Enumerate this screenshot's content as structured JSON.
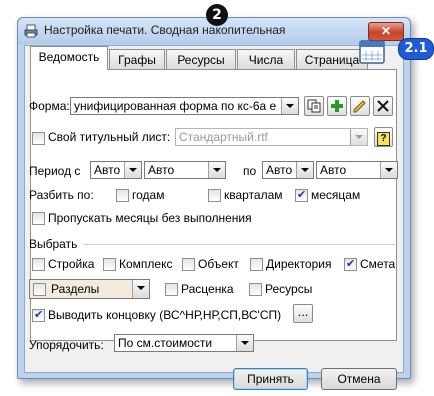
{
  "window": {
    "title": "Настройка печати. Сводная накопительная",
    "close_glyph": "✕"
  },
  "markers": {
    "main": "2",
    "secondary": "2.1"
  },
  "tabs": [
    {
      "label": "Ведомость",
      "active": true
    },
    {
      "label": "Графы",
      "active": false
    },
    {
      "label": "Ресурсы",
      "active": false
    },
    {
      "label": "Числа",
      "active": false
    },
    {
      "label": "Страница",
      "active": false
    }
  ],
  "form": {
    "label": "Форма:",
    "value": "унифицированная форма по кс-6а е"
  },
  "title_page": {
    "checkbox_label": "Свой титульный лист:",
    "checked": false,
    "value": "Стандартный.rtf"
  },
  "period": {
    "from_label": "Период с",
    "to_label": "по",
    "from_1": "Авто",
    "from_2": "Авто",
    "to_1": "Авто",
    "to_2": "Авто"
  },
  "split": {
    "label": "Разбить по:",
    "years": {
      "label": "годам",
      "checked": false
    },
    "quarters": {
      "label": "кварталам",
      "checked": false
    },
    "months": {
      "label": "месяцам",
      "checked": true
    }
  },
  "skip_months": {
    "label": "Пропускать месяцы без выполнения",
    "checked": false
  },
  "select": {
    "heading": "Выбрать",
    "items": [
      {
        "label": "Стройка",
        "checked": false
      },
      {
        "label": "Комплекс",
        "checked": false
      },
      {
        "label": "Объект",
        "checked": false
      },
      {
        "label": "Директория",
        "checked": false
      },
      {
        "label": "Смета",
        "checked": true
      }
    ],
    "sections": {
      "label": "Разделы",
      "checked": false
    },
    "rate": {
      "label": "Расценка",
      "checked": false
    },
    "resources": {
      "label": "Ресурсы",
      "checked": false
    }
  },
  "ending": {
    "label": "Выводить концовку (ВС^НР,НР,СП,ВС'СП)",
    "checked": true,
    "button": "..."
  },
  "order": {
    "label": "Упорядочить:",
    "value": "По см.стоимости"
  },
  "buttons": {
    "ok": "Принять",
    "cancel": "Отмена"
  },
  "icons": {
    "copy": "copy-icon",
    "add": "plus-icon",
    "edit": "pencil-icon",
    "delete": "delete-x-icon",
    "help": "question-icon",
    "calendar": "calendar-icon"
  },
  "colors": {
    "accent": "#1f5bd6",
    "add_green": "#2a9a2a",
    "close_red": "#c7442a"
  }
}
